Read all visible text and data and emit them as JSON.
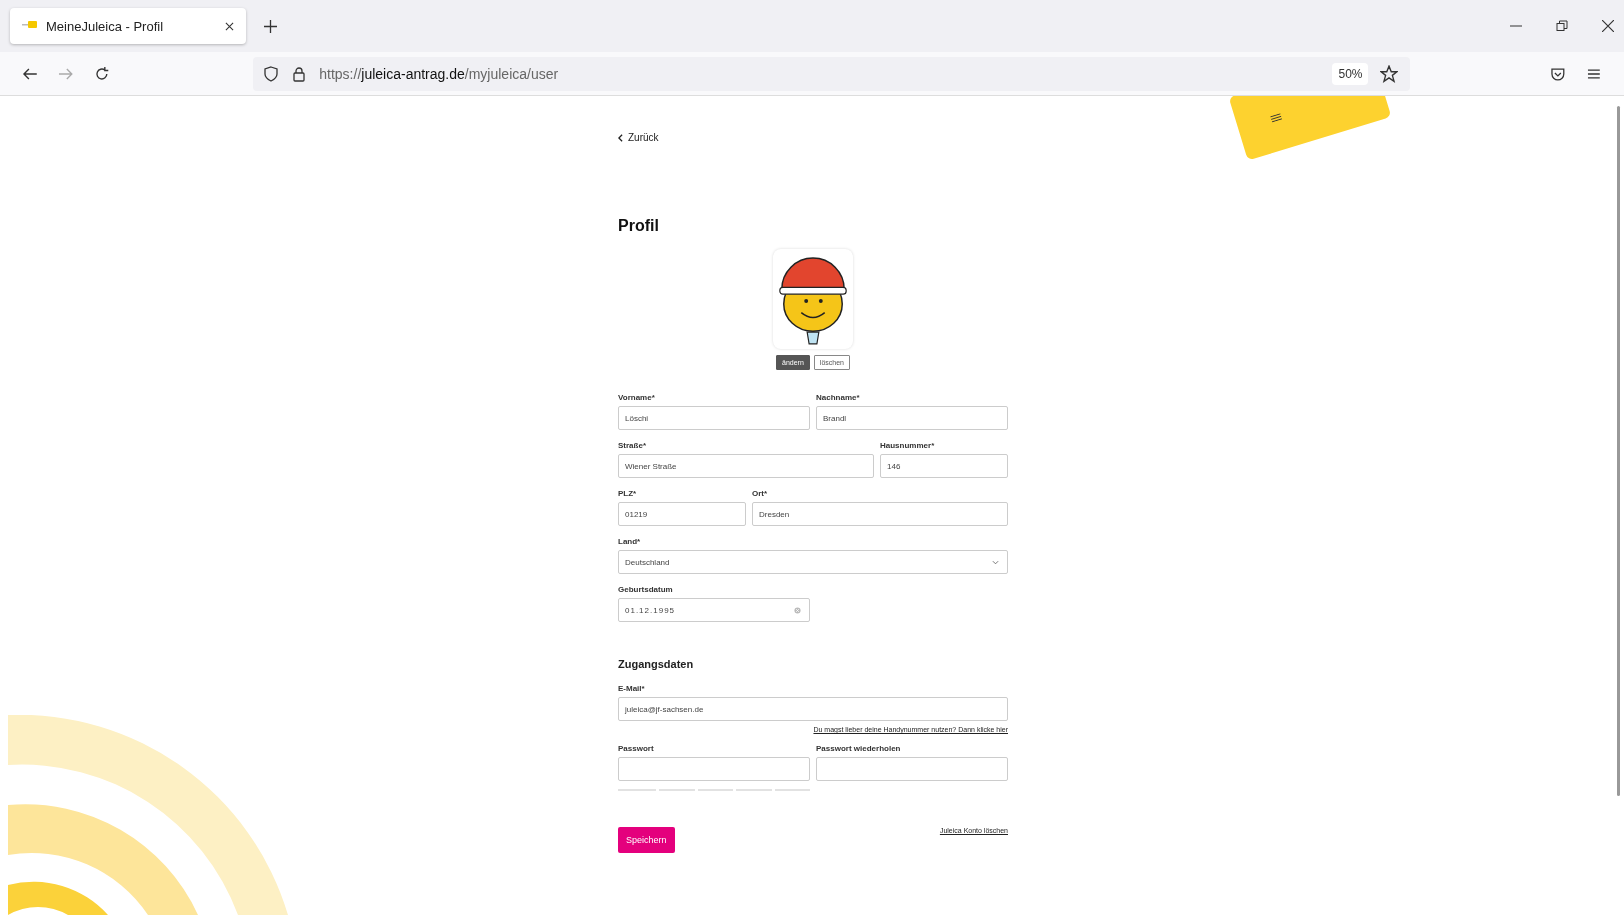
{
  "browser": {
    "tab_title": "MeineJuleica - Profil",
    "url": {
      "scheme": "https://",
      "host": "juleica-antrag.de",
      "path": "/myjuleica/user"
    },
    "zoom": "50%"
  },
  "back_link": "Zurück",
  "title": "Profil",
  "avatar_buttons": [
    {
      "label": "ändern",
      "kind": "primary"
    },
    {
      "label": "löschen",
      "kind": "secondary"
    }
  ],
  "rows": [
    [
      {
        "label": "Vorname*",
        "value": "Löschi",
        "kind": "text"
      },
      {
        "label": "Nachname*",
        "value": "Brandl",
        "kind": "text"
      }
    ],
    [
      {
        "label": "Straße*",
        "value": "Wiener Straße",
        "kind": "text"
      },
      {
        "label": "Hausnummer*",
        "value": "146",
        "kind": "text"
      }
    ],
    [
      {
        "label": "PLZ*",
        "value": "01219",
        "kind": "text"
      },
      {
        "label": "Ort*",
        "value": "Dresden",
        "kind": "text"
      }
    ],
    [
      {
        "label": "Land*",
        "value": "Deutschland",
        "kind": "select"
      }
    ],
    [
      {
        "label": "Geburtsdatum",
        "value": "01.12.1995",
        "kind": "date"
      }
    ]
  ],
  "access": {
    "heading": "Zugangsdaten",
    "email_label": "E-Mail*",
    "email_value": "juleica@jf-sachsen.de",
    "phone_link": "Du magst lieber deine Handynummer nutzen? Dann klicke hier",
    "password_label": "Passwort",
    "password_repeat_label": "Passwort wiederholen"
  },
  "save_button": "Speichern",
  "delete_link": "Juleica Konto löschen"
}
